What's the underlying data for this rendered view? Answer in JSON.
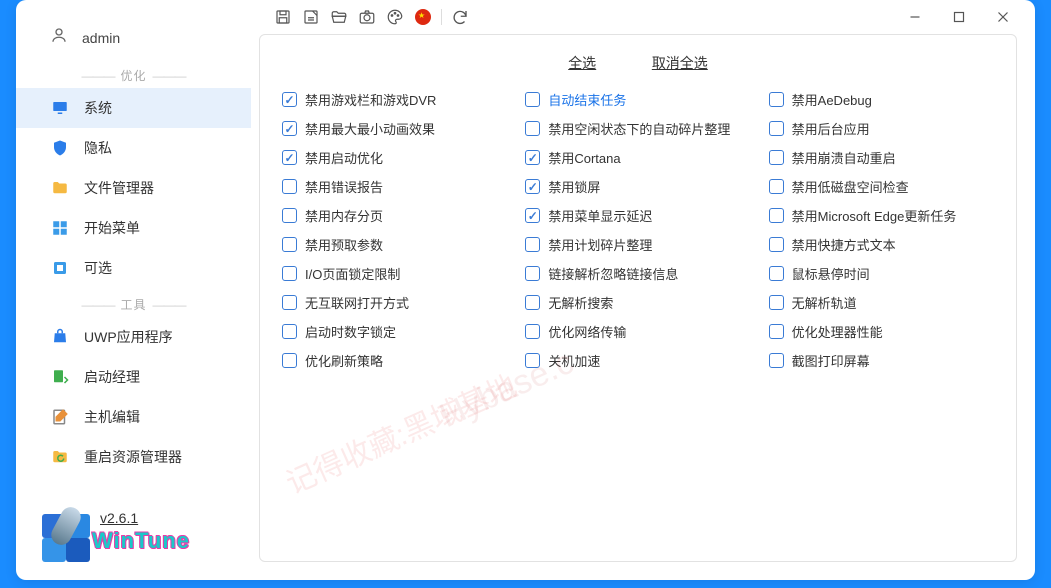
{
  "user": {
    "name": "admin"
  },
  "sidebar": {
    "sections": {
      "optimize": "优化",
      "tools": "工具"
    },
    "items": [
      {
        "key": "system",
        "label": "系统",
        "active": true
      },
      {
        "key": "privacy",
        "label": "隐私"
      },
      {
        "key": "filemanager",
        "label": "文件管理器"
      },
      {
        "key": "startmenu",
        "label": "开始菜单"
      },
      {
        "key": "optional",
        "label": "可选"
      },
      {
        "key": "uwp",
        "label": "UWP应用程序"
      },
      {
        "key": "startupmgr",
        "label": "启动经理"
      },
      {
        "key": "hosteditor",
        "label": "主机编辑"
      },
      {
        "key": "restartexp",
        "label": "重启资源管理器"
      }
    ]
  },
  "brand": {
    "version": "v2.6.1",
    "name": "WinTune"
  },
  "toolbar": {
    "buttons": [
      "save",
      "delete",
      "open",
      "camera",
      "palette",
      "language",
      "refresh"
    ]
  },
  "actions": {
    "select_all": "全选",
    "deselect_all": "取消全选"
  },
  "options": {
    "col1": [
      {
        "label": "禁用游戏栏和游戏DVR",
        "checked": true
      },
      {
        "label": "禁用最大最小动画效果",
        "checked": true
      },
      {
        "label": "禁用启动优化",
        "checked": true
      },
      {
        "label": "禁用错误报告",
        "checked": false
      },
      {
        "label": "禁用内存分页",
        "checked": false
      },
      {
        "label": "禁用预取参数",
        "checked": false
      },
      {
        "label": "I/O页面锁定限制",
        "checked": false
      },
      {
        "label": "无互联网打开方式",
        "checked": false
      },
      {
        "label": "启动时数字锁定",
        "checked": false
      },
      {
        "label": "优化刷新策略",
        "checked": false
      }
    ],
    "col2": [
      {
        "label": "自动结束任务",
        "checked": false,
        "highlight": true
      },
      {
        "label": "禁用空闲状态下的自动碎片整理",
        "checked": false
      },
      {
        "label": "禁用Cortana",
        "checked": true
      },
      {
        "label": "禁用锁屏",
        "checked": true
      },
      {
        "label": "禁用菜单显示延迟",
        "checked": true
      },
      {
        "label": "禁用计划碎片整理",
        "checked": false
      },
      {
        "label": "链接解析忽略链接信息",
        "checked": false
      },
      {
        "label": "无解析搜索",
        "checked": false
      },
      {
        "label": "优化网络传输",
        "checked": false
      },
      {
        "label": "关机加速",
        "checked": false
      }
    ],
    "col3": [
      {
        "label": "禁用AeDebug",
        "checked": false
      },
      {
        "label": "禁用后台应用",
        "checked": false
      },
      {
        "label": "禁用崩溃自动重启",
        "checked": false
      },
      {
        "label": "禁用低磁盘空间检查",
        "checked": false
      },
      {
        "label": "禁用Microsoft Edge更新任务",
        "checked": false
      },
      {
        "label": "禁用快捷方式文本",
        "checked": false
      },
      {
        "label": "鼠标悬停时间",
        "checked": false
      },
      {
        "label": "无解析轨道",
        "checked": false
      },
      {
        "label": "优化处理器性能",
        "checked": false
      },
      {
        "label": "截图打印屏幕",
        "checked": false
      }
    ]
  },
  "watermark": {
    "a": "记得收藏:黑域基地",
    "b": "Hybase.c"
  }
}
